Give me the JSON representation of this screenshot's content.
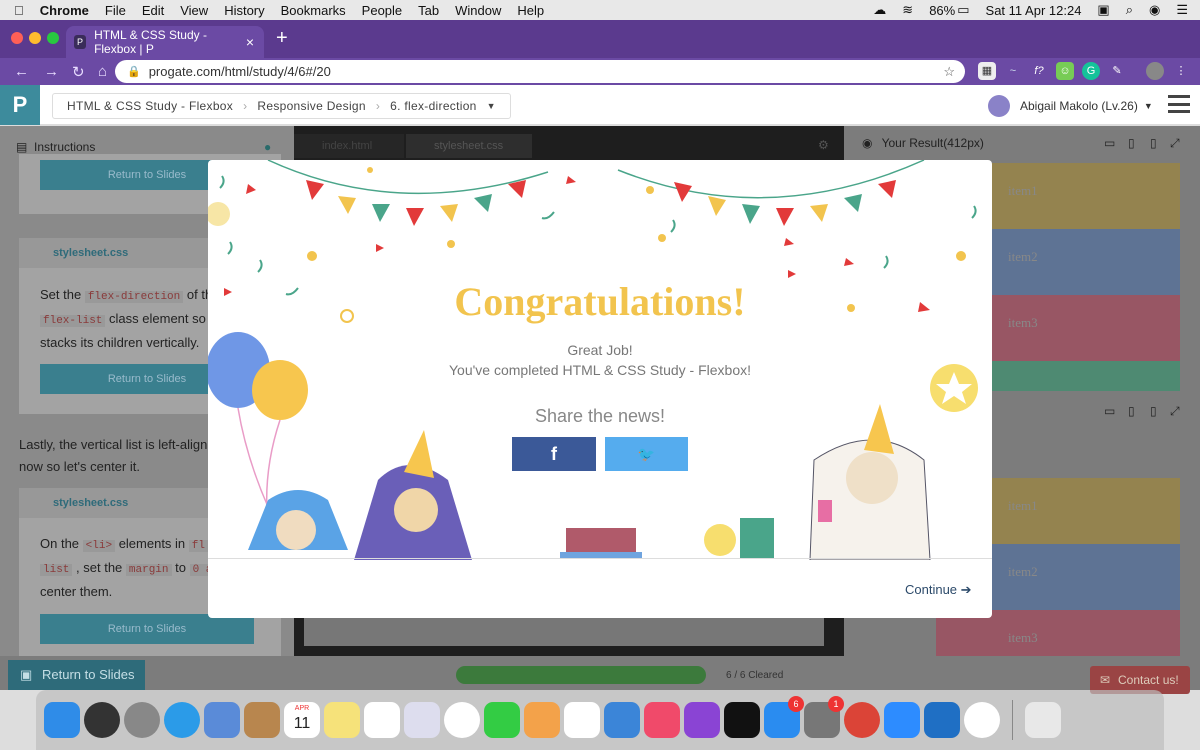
{
  "macbar": {
    "apple": "",
    "menus": [
      "Chrome",
      "File",
      "Edit",
      "View",
      "History",
      "Bookmarks",
      "People",
      "Tab",
      "Window",
      "Help"
    ],
    "battery": "86%",
    "datetime": "Sat 11 Apr  12:24"
  },
  "browser": {
    "tab_title": "HTML & CSS Study - Flexbox | P",
    "url": "progate.com/html/study/4/6#/20"
  },
  "app": {
    "logo": "P",
    "breadcrumbs": [
      "HTML & CSS Study - Flexbox",
      "Responsive Design",
      "6. flex-direction"
    ],
    "user": "Abigail Makolo (Lv.26)"
  },
  "left": {
    "instructions": "Instructions",
    "return_to_slides": "Return to Slides",
    "file1": "stylesheet.css",
    "t1a": "Set the",
    "t1b": "flex-direction",
    "t1c": "of th",
    "t1d": "flex-list",
    "t1e": "class element so",
    "t1f": "stacks its children vertically.",
    "t2": "Lastly, the vertical list is left-align",
    "t2b": "now so let's center it.",
    "file2": "stylesheet.css",
    "t3a": "On the",
    "t3b": "<li>",
    "t3c": "elements in",
    "t3d": "fl",
    "t3e": "list",
    "t3f": ", set the",
    "t3g": "margin",
    "t3h": "to",
    "t3i": "0 a",
    "t3j": "center them."
  },
  "editor": {
    "tab1": "index.html",
    "tab2": "stylesheet.css"
  },
  "right": {
    "result": "Your Result(412px)",
    "items_top": [
      "item1",
      "item2",
      "item3"
    ],
    "items_bottom": [
      "item1",
      "item2",
      "item3"
    ]
  },
  "footer": {
    "return": "Return to Slides",
    "progress": "6 / 6 Cleared",
    "progress_fraction": 1.0,
    "contact": "Contact us!"
  },
  "modal": {
    "title": "Congratulations!",
    "line1": "Great Job!",
    "line2": "You've completed HTML & CSS Study - Flexbox!",
    "share": "Share the news!",
    "fb": "f",
    "tw": "🐦",
    "continue": "Continue ➔"
  },
  "dock": {
    "calendar_month": "APR",
    "calendar_day": "11",
    "appstore_badge": "6",
    "settings_badge": "1"
  },
  "colors": {
    "accent": "#3d8b9c",
    "congrats": "#f2c44e",
    "facebook": "#3b5998",
    "twitter": "#55acee",
    "chrome_purple": "#5b3a8e"
  }
}
